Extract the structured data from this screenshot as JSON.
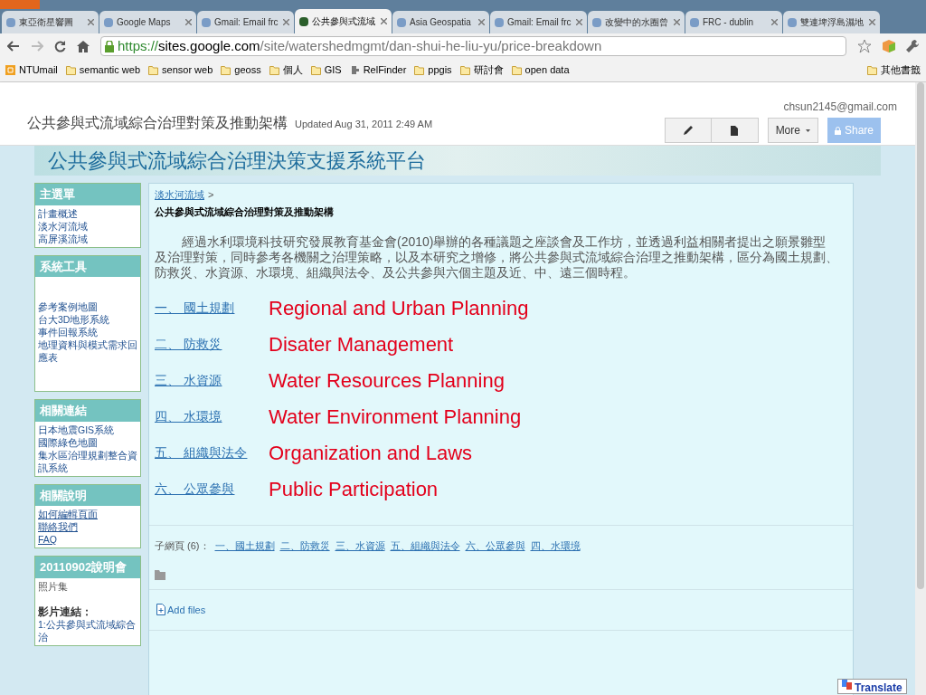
{
  "tabs": [
    {
      "title": "東亞衛星響圖",
      "selected": false
    },
    {
      "title": "Google Maps",
      "selected": false
    },
    {
      "title": "Gmail: Email frc",
      "selected": false
    },
    {
      "title": "公共參與式流域",
      "selected": true
    },
    {
      "title": "Asia Geospatia",
      "selected": false
    },
    {
      "title": "Gmail: Email frc",
      "selected": false
    },
    {
      "title": "改變中的水圈曾",
      "selected": false
    },
    {
      "title": "FRC - dublin",
      "selected": false
    },
    {
      "title": "雙連埤浮島濕地",
      "selected": false
    }
  ],
  "address": {
    "scheme": "https://",
    "host": "sites.google.com",
    "path": "/site/watershedmgmt/dan-shui-he-liu-yu/price-breakdown"
  },
  "bookmarks": [
    {
      "label": "NTUmail",
      "kind": "mail"
    },
    {
      "label": "semantic web",
      "kind": "folder"
    },
    {
      "label": "sensor web",
      "kind": "folder"
    },
    {
      "label": "geoss",
      "kind": "folder"
    },
    {
      "label": "個人",
      "kind": "folder"
    },
    {
      "label": "GIS",
      "kind": "folder"
    },
    {
      "label": "RelFinder",
      "kind": "plugin"
    },
    {
      "label": "ppgis",
      "kind": "folder"
    },
    {
      "label": "研討會",
      "kind": "folder"
    },
    {
      "label": "open data",
      "kind": "folder"
    }
  ],
  "other_bookmarks": "其他書籤",
  "header": {
    "site_name": "公共參與式流域綜合治理對策及推動架構",
    "updated": "Updated Aug 31, 2011 2:49 AM",
    "account": "chsun2145@gmail.com",
    "more": "More",
    "share": "Share"
  },
  "banner_title": "公共參與式流域綜合治理決策支援系統平台",
  "sidebar": [
    {
      "title": "主選單",
      "items": [
        {
          "text": "計畫概述",
          "kind": "link"
        },
        {
          "text": "淡水河流域",
          "kind": "link"
        },
        {
          "text": "高屏溪流域",
          "kind": "link"
        }
      ]
    },
    {
      "title": "系統工具",
      "items": [
        {
          "text": "參考案例地圖",
          "kind": "link"
        },
        {
          "text": "台大3D地形系統",
          "kind": "link"
        },
        {
          "text": "事件回報系統",
          "kind": "link"
        },
        {
          "text": "地理資料與模式需求回應表",
          "kind": "link"
        }
      ]
    },
    {
      "title": "相關連結",
      "items": [
        {
          "text": "日本地震GIS系統",
          "kind": "link"
        },
        {
          "text": "國際綠色地圖",
          "kind": "link"
        },
        {
          "text": "集水區治理規劃整合資訊系統",
          "kind": "link"
        }
      ]
    },
    {
      "title": "相關說明",
      "items": [
        {
          "text": "如何編輯頁面",
          "kind": "underlined"
        },
        {
          "text": "聯絡我們",
          "kind": "underlined"
        },
        {
          "text": "FAQ",
          "kind": "underlined"
        }
      ]
    },
    {
      "title": "20110902說明會",
      "items": [
        {
          "text": "照片集",
          "kind": "plain"
        },
        {
          "text": "影片連結：",
          "kind": "heading"
        },
        {
          "text": "1:公共參與式流域綜合治",
          "kind": "link"
        }
      ]
    }
  ],
  "content": {
    "breadcrumb": "淡水河流域",
    "separator": ">",
    "page_title": "公共參與式流域綜合治理對策及推動架構",
    "paragraph": "經過水利環境科技研究發展教育基金會(2010)舉辦的各種議題之座談會及工作坊，並透過利益相關者提出之願景雛型及治理對策，同時參考各機關之治理策略，以及本研究之增修，將公共參與式流域綜合治理之推動架構，區分為國土規劃、防救災、水資源、水環境、組織與法令、及公共參與六個主題及近、中、遠三個時程。",
    "topics": [
      {
        "link": "一、 國土規劃",
        "english": "Regional and Urban Planning"
      },
      {
        "link": "二、 防救災",
        "english": "Disater Management"
      },
      {
        "link": "三、 水資源",
        "english": "Water Resources Planning"
      },
      {
        "link": "四、 水環境",
        "english": "Water Environment Planning"
      },
      {
        "link": "五、 組織與法令",
        "english": "Organization and Laws"
      },
      {
        "link": "六、 公眾參與",
        "english": "Public Participation"
      }
    ],
    "subpages_label": "子網頁 (6)：",
    "subpages": [
      "一、國土規劃",
      "二、防救災",
      "三、水資源",
      "五、組織與法令",
      "六、公眾參與",
      "四、水環境"
    ],
    "add_files": "Add files",
    "translate": "Translate"
  }
}
